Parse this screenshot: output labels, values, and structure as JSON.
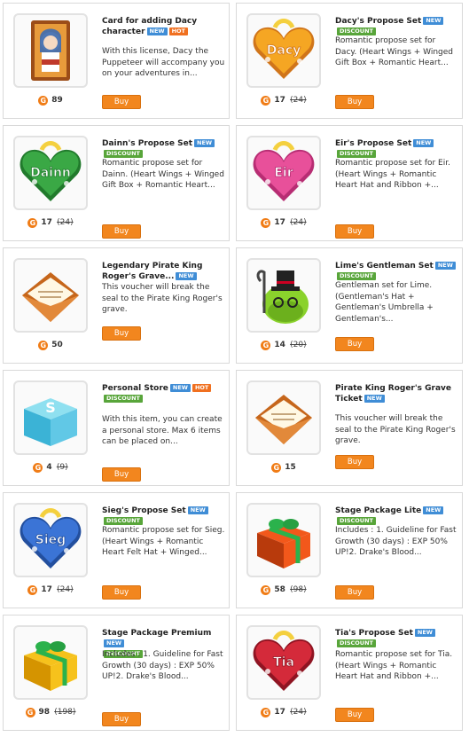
{
  "currency_icon": "G",
  "items": [
    {
      "title": "Card for adding Dacy character",
      "badges": [
        "NEW",
        "HOT"
      ],
      "description": "With this license, Dacy the Puppeteer will accompany you on your adventures in...",
      "price": "89",
      "old_price": "",
      "buy": "Buy",
      "icon": "character-card-icon"
    },
    {
      "title": "Dacy's Propose Set",
      "badges": [
        "NEW",
        "DISCOUNT"
      ],
      "description": "Romantic propose set for Dacy. (Heart Wings + Winged Gift Box + Romantic Heart...",
      "price": "17",
      "old_price": "24",
      "buy": "Buy",
      "icon": "heart-box-icon",
      "label": "Dacy"
    },
    {
      "title": "Dainn's Propose Set",
      "badges": [
        "NEW",
        "DISCOUNT"
      ],
      "description": "Romantic propose set for Dainn. (Heart Wings + Winged Gift Box + Romantic Heart...",
      "price": "17",
      "old_price": "24",
      "buy": "Buy",
      "icon": "heart-box-icon",
      "label": "Dainn"
    },
    {
      "title": "Eir's Propose Set",
      "badges": [
        "NEW",
        "DISCOUNT"
      ],
      "description": "Romantic propose set for Eir. (Heart Wings + Romantic Heart Hat and Ribbon +...",
      "price": "17",
      "old_price": "24",
      "buy": "Buy",
      "icon": "heart-box-icon",
      "label": "Eir"
    },
    {
      "title": "Legendary Pirate King Roger's Grave...",
      "badges": [
        "NEW"
      ],
      "description": "This voucher will break the seal to the Pirate King Roger's grave.",
      "price": "50",
      "old_price": "",
      "buy": "Buy",
      "icon": "envelope-icon"
    },
    {
      "title": "Lime's Gentleman Set",
      "badges": [
        "NEW",
        "DISCOUNT"
      ],
      "description": "Gentleman set for Lime. (Gentleman's Hat + Gentleman's Umbrella + Gentleman's...",
      "price": "14",
      "old_price": "20",
      "buy": "Buy",
      "icon": "lime-gentleman-icon"
    },
    {
      "title": "Personal Store",
      "badges": [
        "NEW",
        "HOT",
        "DISCOUNT"
      ],
      "description": "With this item, you can create a personal store. Max 6 items can be placed on...",
      "price": "4",
      "old_price": "9",
      "buy": "Buy",
      "icon": "store-box-icon"
    },
    {
      "title": "Pirate King Roger's Grave Ticket",
      "badges": [
        "NEW"
      ],
      "description": "This voucher will break the seal to the Pirate King Roger's grave.",
      "price": "15",
      "old_price": "",
      "buy": "Buy",
      "icon": "envelope-icon"
    },
    {
      "title": "Sieg's Propose Set",
      "badges": [
        "NEW",
        "DISCOUNT"
      ],
      "description": "Romantic propose set for Sieg. (Heart Wings + Romantic Heart Felt Hat + Winged...",
      "price": "17",
      "old_price": "24",
      "buy": "Buy",
      "icon": "heart-box-icon",
      "label": "Sieg"
    },
    {
      "title": "Stage Package Lite",
      "badges": [
        "NEW",
        "DISCOUNT"
      ],
      "description": "Includes : 1. Guideline for Fast Growth (30 days) : EXP 50% UP!2. Drake's Blood...",
      "price": "58",
      "old_price": "98",
      "buy": "Buy",
      "icon": "gift-box-icon"
    },
    {
      "title": "Stage Package Premium",
      "badges": [
        "NEW",
        "DISCOUNT"
      ],
      "description": "Includes : 1. Guideline for Fast Growth (30 days) : EXP 50% UP!2. Drake's Blood...",
      "price": "98",
      "old_price": "198",
      "buy": "Buy",
      "icon": "gift-box-icon"
    },
    {
      "title": "Tia's Propose Set",
      "badges": [
        "NEW",
        "DISCOUNT"
      ],
      "description": "Romantic propose set for Tia. (Heart Wings + Romantic Heart Hat and Ribbon +...",
      "price": "17",
      "old_price": "24",
      "buy": "Buy",
      "icon": "heart-box-icon",
      "label": "Tia"
    }
  ],
  "colors": {
    "buy_button": "#f2861e",
    "new_badge": "#3f8dd6",
    "hot_badge": "#f07020",
    "discount_badge": "#58a53a",
    "dacy_heart": "#f5a623",
    "dainn_heart": "#3aa845",
    "eir_heart": "#e8509a",
    "sieg_heart": "#3b74d6",
    "tia_heart": "#d42a3a"
  }
}
